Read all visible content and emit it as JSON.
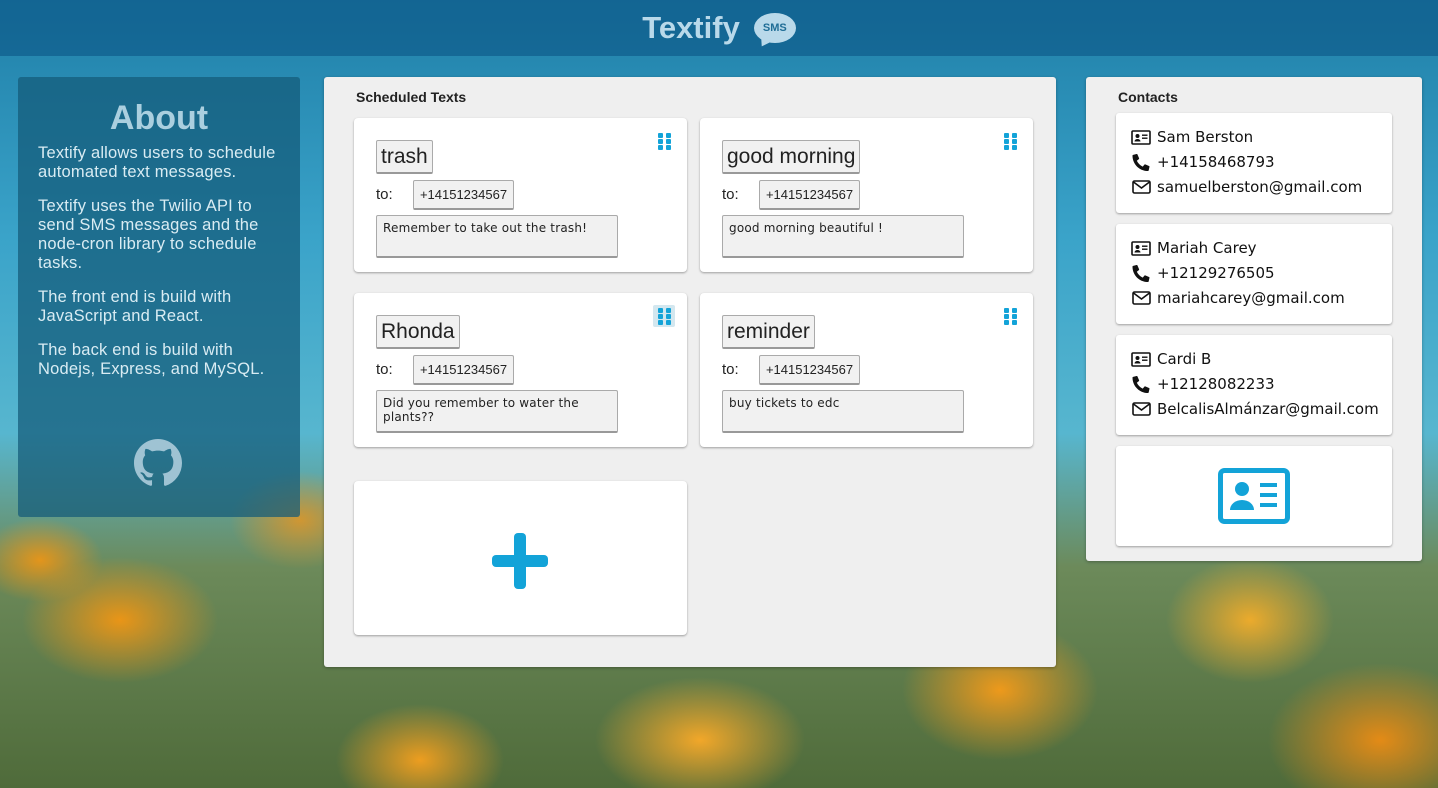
{
  "header": {
    "title": "Textify",
    "logo_text": "SMS"
  },
  "about": {
    "title": "About",
    "paragraphs": [
      "Textify allows users to schedule automated text messages.",
      "Textify uses the Twilio API to send SMS messages and the node-cron library to schedule tasks.",
      "The front end is build with JavaScript and React.",
      "The back end is build with Nodejs, Express, and MySQL."
    ],
    "github_icon": "github-icon"
  },
  "scheduled": {
    "title": "Scheduled Texts",
    "to_label": "to:",
    "cards": [
      {
        "title": "trash",
        "phone": "+14151234567",
        "message": "Remember to take out the trash!"
      },
      {
        "title": "good morning",
        "phone": "+14151234567",
        "message": "good morning beautiful !"
      },
      {
        "title": "Rhonda",
        "phone": "+14151234567",
        "message": "Did you remember to water the plants??"
      },
      {
        "title": "reminder",
        "phone": "+14151234567",
        "message": "buy tickets to edc"
      }
    ],
    "add_icon": "plus-icon"
  },
  "contacts": {
    "title": "Contacts",
    "items": [
      {
        "name": "Sam Berston",
        "phone": "+14158468793",
        "email": "samuelberston@gmail.com"
      },
      {
        "name": "Mariah Carey",
        "phone": "+12129276505",
        "email": "mariahcarey@gmail.com"
      },
      {
        "name": "Cardi B",
        "phone": "+12128082233",
        "email": "BelcalisAlmánzar@gmail.com"
      }
    ],
    "add_icon": "id-card-icon"
  },
  "colors": {
    "accent": "#13a3d8",
    "header_bg": "#0a5082",
    "about_bg": "#145a78",
    "panel_bg": "#efefef"
  }
}
